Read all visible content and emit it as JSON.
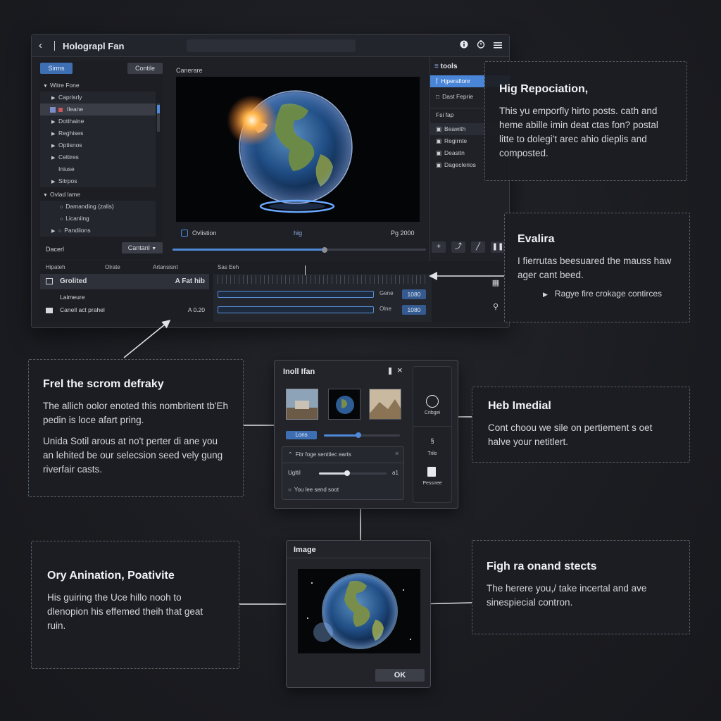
{
  "window": {
    "title": "Holograpl Fan",
    "left": {
      "btn_primary": "Sirms",
      "btn_secondary": "Contile",
      "group1": "Witre Fone",
      "items": [
        "Caprisrly",
        "Ileane",
        "Dotthaine",
        "Reghises",
        "Optisnos",
        "Celtires",
        "Iniuse",
        "Sitrpos"
      ],
      "group2": "Ovlad lame",
      "items2": [
        "Damanding (zalis)",
        "Licaniing",
        "Pandiions"
      ],
      "footer_label": "Dacerl",
      "footer_btn": "Cantanl"
    },
    "preview": {
      "label": "Canerare",
      "caption_left": "Ovlistion",
      "caption_mid": "hig",
      "caption_right": "Pg 2000",
      "progress": 0.6
    },
    "tools": {
      "header": "tools",
      "items": [
        "Hjperafionr",
        "Dast Feprie"
      ],
      "section": "Fsi fap",
      "list": [
        "Beawith",
        "Regirnte",
        "Deasitn",
        "Dageclerios"
      ]
    },
    "timeline": {
      "headers": [
        "Hipateh",
        "Olrate",
        "Artansisnt",
        "Sas Eeh"
      ],
      "tracks": [
        {
          "name": "Grolited",
          "value": "A Fat hib"
        },
        {
          "name": "Laimeure",
          "value": ""
        },
        {
          "name": "Canell act prahel",
          "value": "A 0.20"
        }
      ],
      "rows": [
        {
          "label": "Gene",
          "badge": "1080"
        },
        {
          "label": "Olne",
          "badge": "1080"
        }
      ]
    }
  },
  "callouts": {
    "c1": {
      "title": "Hig Repociation,",
      "body": "This yu emporfly hirto posts. cath and heme abille imin deat ctas fon? postal litte to dolegi't arec ahio dieplis and composted."
    },
    "c2": {
      "title": "Evalira",
      "line1": "I fierrutas beesuared the mauss haw ager cant beed.",
      "bullet": "Ragye fire crokage contirces"
    },
    "c3": {
      "title": "Frel the scrom defraky",
      "p1": "The allich oolor enoted this nombritent tb'Eh pedin is loce afart pring.",
      "p2": "Unida Sotil arous at no't perter di ane you an lehited be our selecsion seed vely gung riverfair casts."
    },
    "c4": {
      "title": "Heb Imedial",
      "body": "Cont choou we sile on pertiement s oet halve your netitlert."
    },
    "c5": {
      "title": "Ory Anination, Poativite",
      "body": "His guiring the Uce hillo nooh to dlenopion his effemed theih that geat ruin."
    },
    "c6": {
      "title": "Figh ra onand stects",
      "body": "The herere you,/ take incertal and ave sinespiecial contron."
    }
  },
  "dialog1": {
    "title": "Inoll Ifan",
    "btn": "Lons",
    "slider": 0.45,
    "group_title": "Fitr foge senttiec earts",
    "row_label": "Ugltil",
    "row_value": "a1",
    "check_label": "You lee send soot",
    "side1": "Cribgei",
    "side2": "Trile",
    "side3": "Pessnee"
  },
  "dialog2": {
    "title": "Image",
    "ok": "OK"
  }
}
